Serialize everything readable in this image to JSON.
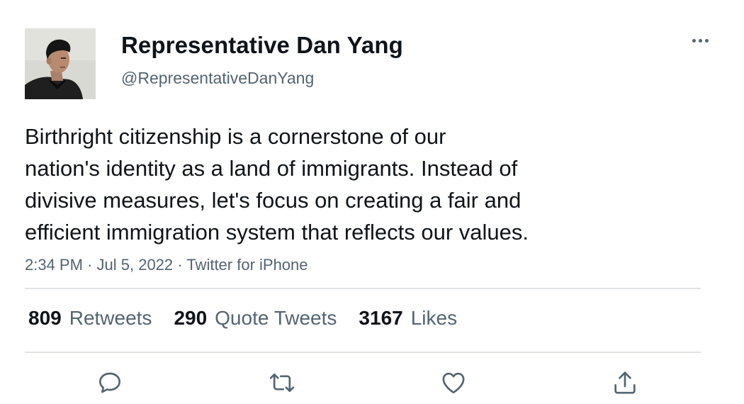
{
  "tweet": {
    "display_name": "Representative Dan Yang",
    "handle": "@RepresentativeDanYang",
    "text": "Birthright citizenship is a cornerstone of our\nnation's identity as a land of immigrants. Instead of\ndivisive measures, let's focus on creating a fair and\nefficient immigration system that reflects our values.",
    "time": "2:34 PM",
    "date": "Jul 5, 2022",
    "source": "Twitter for iPhone",
    "separator": "·"
  },
  "stats": {
    "retweets_count": "809",
    "retweets_label": "Retweets",
    "quotes_count": "290",
    "quotes_label": "Quote Tweets",
    "likes_count": "3167",
    "likes_label": "Likes"
  },
  "icons": {
    "more": "more-horizontal-icon",
    "reply": "reply-icon",
    "retweet": "retweet-icon",
    "like": "heart-icon",
    "share": "share-icon"
  },
  "colors": {
    "text_primary": "#0f1419",
    "text_secondary": "#536471",
    "divider": "#e1e4e6",
    "background": "#ffffff"
  }
}
